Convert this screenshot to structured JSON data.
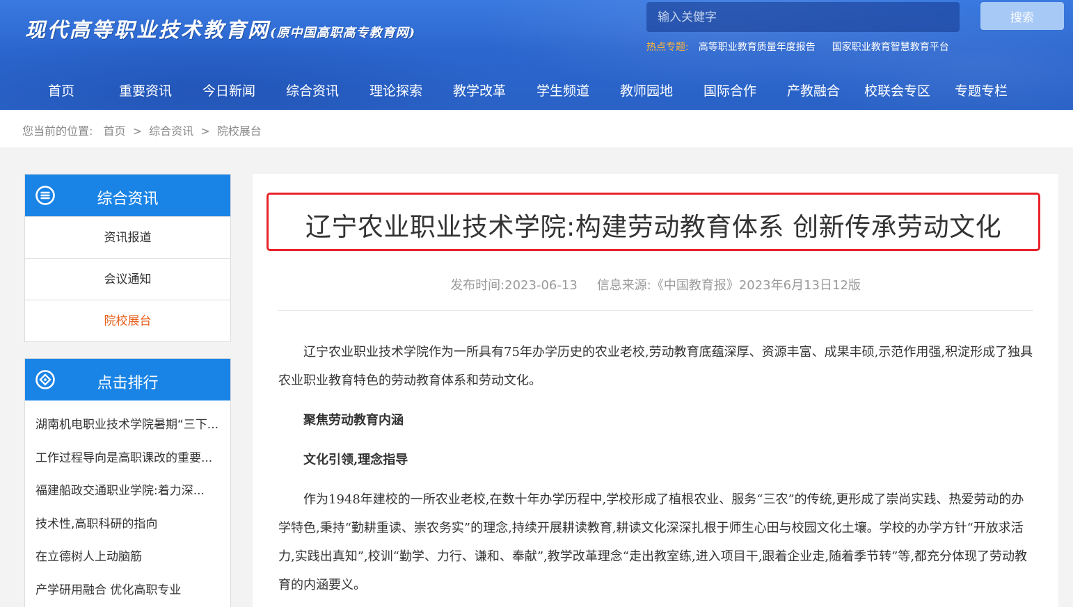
{
  "header": {
    "logo_main": "现代高等职业技术教育网",
    "logo_sub": "(原中国高职高专教育网)",
    "search_placeholder": "输入关健字",
    "search_button": "搜索",
    "hot_label": "热点专题:",
    "hot_links": [
      "高等职业教育质量年度报告",
      "国家职业教育智慧教育平台"
    ]
  },
  "nav": [
    "首页",
    "重要资讯",
    "今日新闻",
    "综合资讯",
    "理论探索",
    "教学改革",
    "学生频道",
    "教师园地",
    "国际合作",
    "产教融合",
    "校联会专区",
    "专题专栏"
  ],
  "breadcrumb": {
    "prefix": "您当前的位置:",
    "items": [
      "首页",
      "综合资讯",
      "院校展台"
    ],
    "separator": ">"
  },
  "sidebar": {
    "category": {
      "title": "综合资讯",
      "items": [
        "资讯报道",
        "会议通知",
        "院校展台"
      ],
      "active_index": 2
    },
    "ranking": {
      "title": "点击排行",
      "items": [
        "湖南机电职业技术学院暑期“三下...",
        "工作过程导向是高职课改的重要...",
        "福建船政交通职业学院:着力深...",
        "技术性,高职科研的指向",
        "在立德树人上动脑筋",
        "产学研用融合 优化高职专业"
      ]
    }
  },
  "article": {
    "title": "辽宁农业职业技术学院:构建劳动教育体系 创新传承劳动文化",
    "publish": "发布时间:2023-06-13",
    "source": "信息来源:《中国教育报》2023年6月13日12版",
    "p1": "辽宁农业职业技术学院作为一所具有75年办学历史的农业老校,劳动教育底蕴深厚、资源丰富、成果丰硕,示范作用强,积淀形成了独具农业职业教育特色的劳动教育体系和劳动文化。",
    "h1": "聚焦劳动教育内涵",
    "h2": "文化引领,理念指导",
    "p2": "作为1948年建校的一所农业老校,在数十年办学历程中,学校形成了植根农业、服务“三农”的传统,更形成了崇尚实践、热爱劳动的办学特色,秉持“勤耕重读、崇农务实”的理念,持续开展耕读教育,耕读文化深深扎根于师生心田与校园文化土壤。学校的办学方针“开放求活力,实践出真知”,校训“勤学、力行、谦和、奉献”,教学改革理念“走出教室练,进入项目干,跟着企业走,随着季节转”等,都充分体现了劳动教育的内涵要义。"
  },
  "colors": {
    "header_blue": "#2b66cf",
    "sidebar_blue": "#1a84e6",
    "active_orange": "#e8601c",
    "highlight_red": "#e8232b",
    "hot_label": "#ffb43a"
  }
}
